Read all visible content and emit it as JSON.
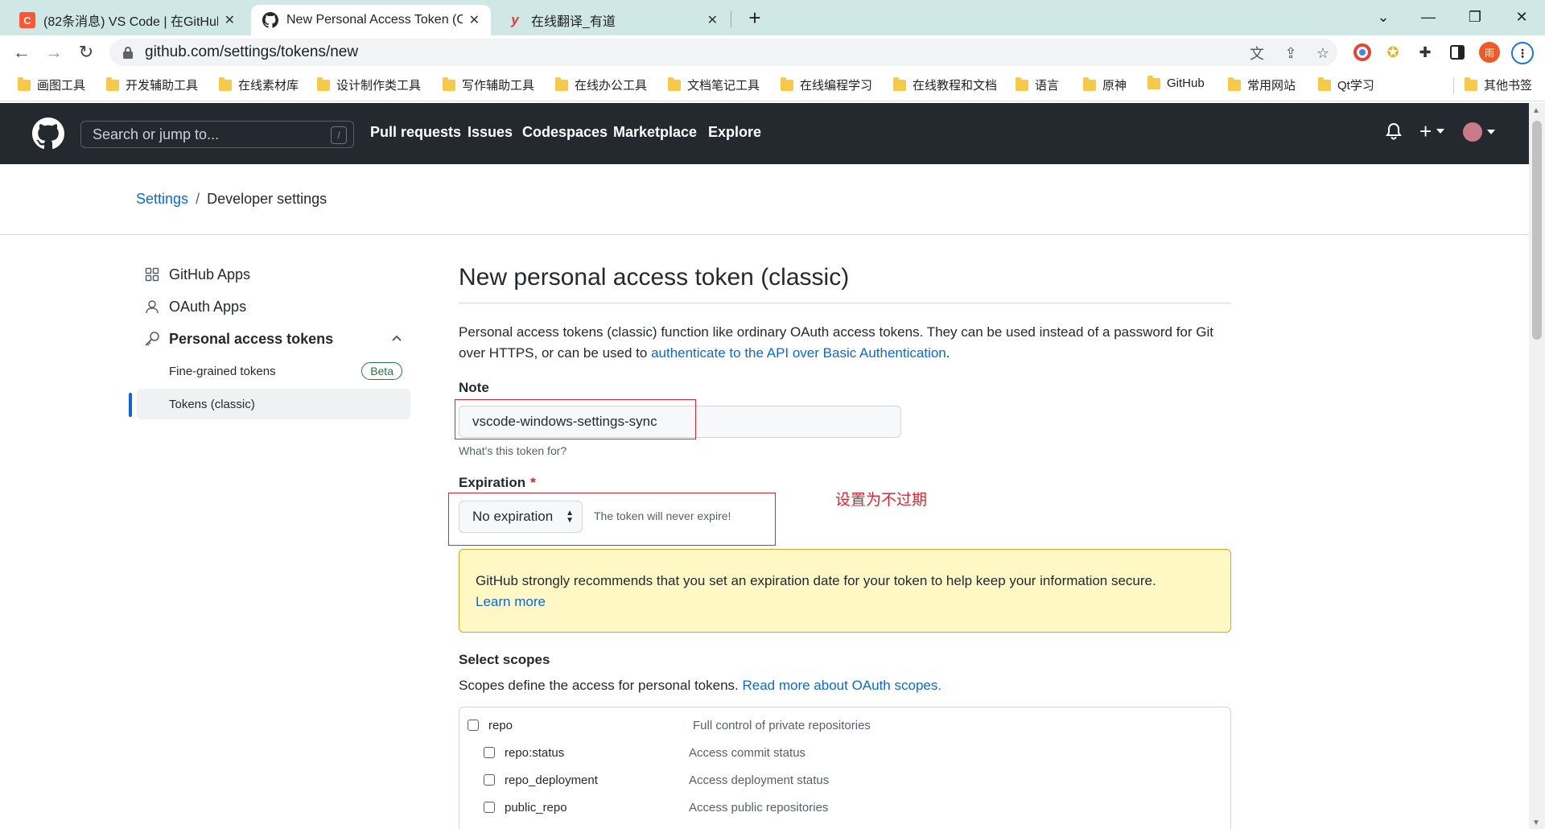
{
  "browser": {
    "tabs": [
      {
        "favicon": "C",
        "title": "(82条消息) VS Code | 在GitHub"
      },
      {
        "favicon": "github-icon",
        "title": "New Personal Access Token (C"
      },
      {
        "favicon": "y",
        "title": "在线翻译_有道"
      }
    ],
    "url": "github.com/settings/tokens/new",
    "bookmarks": [
      "画图工具",
      "开发辅助工具",
      "在线素材库",
      "设计制作类工具",
      "写作辅助工具",
      "在线办公工具",
      "文档笔记工具",
      "在线编程学习",
      "在线教程和文档",
      "语言",
      "原神",
      "GitHub",
      "常用网站",
      "Qt学习",
      "其他书签"
    ],
    "profile_letter": "雨"
  },
  "gh": {
    "search_placeholder": "Search or jump to...",
    "search_key": "/",
    "nav": [
      "Pull requests",
      "Issues",
      "Codespaces",
      "Marketplace",
      "Explore"
    ]
  },
  "breadcrumb": {
    "settings": "Settings",
    "sep": "/",
    "current": "Developer settings"
  },
  "sidebar": {
    "github_apps": "GitHub Apps",
    "oauth_apps": "OAuth Apps",
    "pat": "Personal access tokens",
    "fine_grained": "Fine-grained tokens",
    "beta": "Beta",
    "classic": "Tokens (classic)"
  },
  "main": {
    "title": "New personal access token (classic)",
    "intro_line1": "Personal access tokens (classic) function like ordinary OAuth access tokens. They can be used instead of a password for Git",
    "intro_line2": "over HTTPS, or can be used to ",
    "intro_link": "authenticate to the API over Basic Authentication",
    "intro_end": ".",
    "note_label": "Note",
    "note_value": "vscode-windows-settings-sync",
    "note_hint": "What's this token for?",
    "expiration_label": "Expiration",
    "required_mark": "*",
    "expiration_value": "No expiration",
    "expiration_note": "The token will never expire!",
    "annotation": "设置为不过期",
    "warning_text": "GitHub strongly recommends that you set an expiration date for your token to help keep your information secure.",
    "warning_link": "Learn more",
    "scopes_title": "Select scopes",
    "scopes_desc": "Scopes define the access for personal tokens. ",
    "scopes_link": "Read more about OAuth scopes.",
    "scopes": [
      {
        "name": "repo",
        "desc": "Full control of private repositories",
        "checked": false
      },
      {
        "name": "repo:status",
        "desc": "Access commit status",
        "checked": false
      },
      {
        "name": "repo_deployment",
        "desc": "Access deployment status",
        "checked": false
      },
      {
        "name": "public_repo",
        "desc": "Access public repositories",
        "checked": false
      }
    ]
  },
  "colors": {
    "accent": "#0969da",
    "header_bg": "#24292f",
    "annotation_red": "#e0242f",
    "warning_bg": "#fff8c5",
    "beta_green": "#1a7f37"
  }
}
